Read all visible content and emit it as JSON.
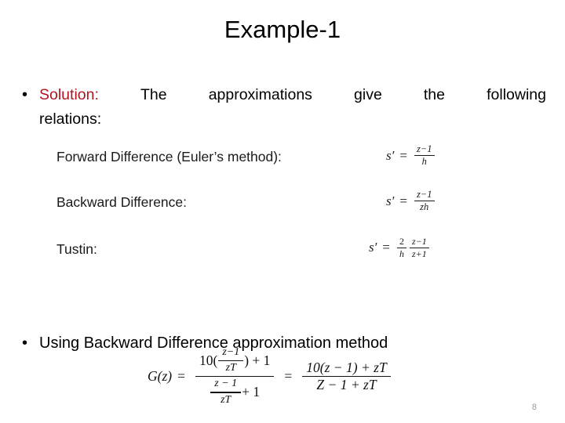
{
  "slide": {
    "title": "Example-1",
    "page_number": "8",
    "accent_color": "#B01520"
  },
  "bullet_1": {
    "marker": "•",
    "keyword": "Solution:",
    "line_1_words": [
      "The",
      "approximations",
      "give",
      "the",
      "following"
    ],
    "line_2": "relations:"
  },
  "formulas": {
    "rows": [
      {
        "label": "Forward Difference (Euler’s method):",
        "equation_text": "s' = (z−1)/h",
        "lhs": "s",
        "prime": "′",
        "equals": "=",
        "numerator": "z−1",
        "denominator": "h"
      },
      {
        "label": "Backward Difference:",
        "equation_text": "s' = (z−1)/(zh)",
        "lhs": "s",
        "prime": "′",
        "equals": "=",
        "numerator": "z−1",
        "denominator": "zh"
      },
      {
        "label": "Tustin:",
        "equation_text": "s' = (2/h)·((z−1)/(z+1))",
        "lhs": "s",
        "prime": "′",
        "equals": "=",
        "factor_numerator": "2",
        "factor_denominator": "h",
        "numerator": "z−1",
        "denominator": "z+1"
      }
    ]
  },
  "bullet_2": {
    "marker": "•",
    "text": "Using Backward Difference approximation method"
  },
  "big_equation": {
    "full_text": "G(z) = [10((z−1)/(zT)) + 1] / [((z−1)/(zT)) + 1] = [10(z−1) + zT] / [Z − 1 + zT]",
    "lhs": "G(z)",
    "equals_1": "=",
    "left_num_prefix": "10(",
    "left_num_frac_num": "z−1",
    "left_num_frac_den": "zT",
    "left_num_suffix": ") + 1",
    "left_den_frac_num": "z − 1",
    "left_den_frac_den": "zT",
    "left_den_suffix": "+ 1",
    "equals_2": "=",
    "right_num": "10(z − 1) + zT",
    "right_den": "Z − 1 + zT"
  }
}
